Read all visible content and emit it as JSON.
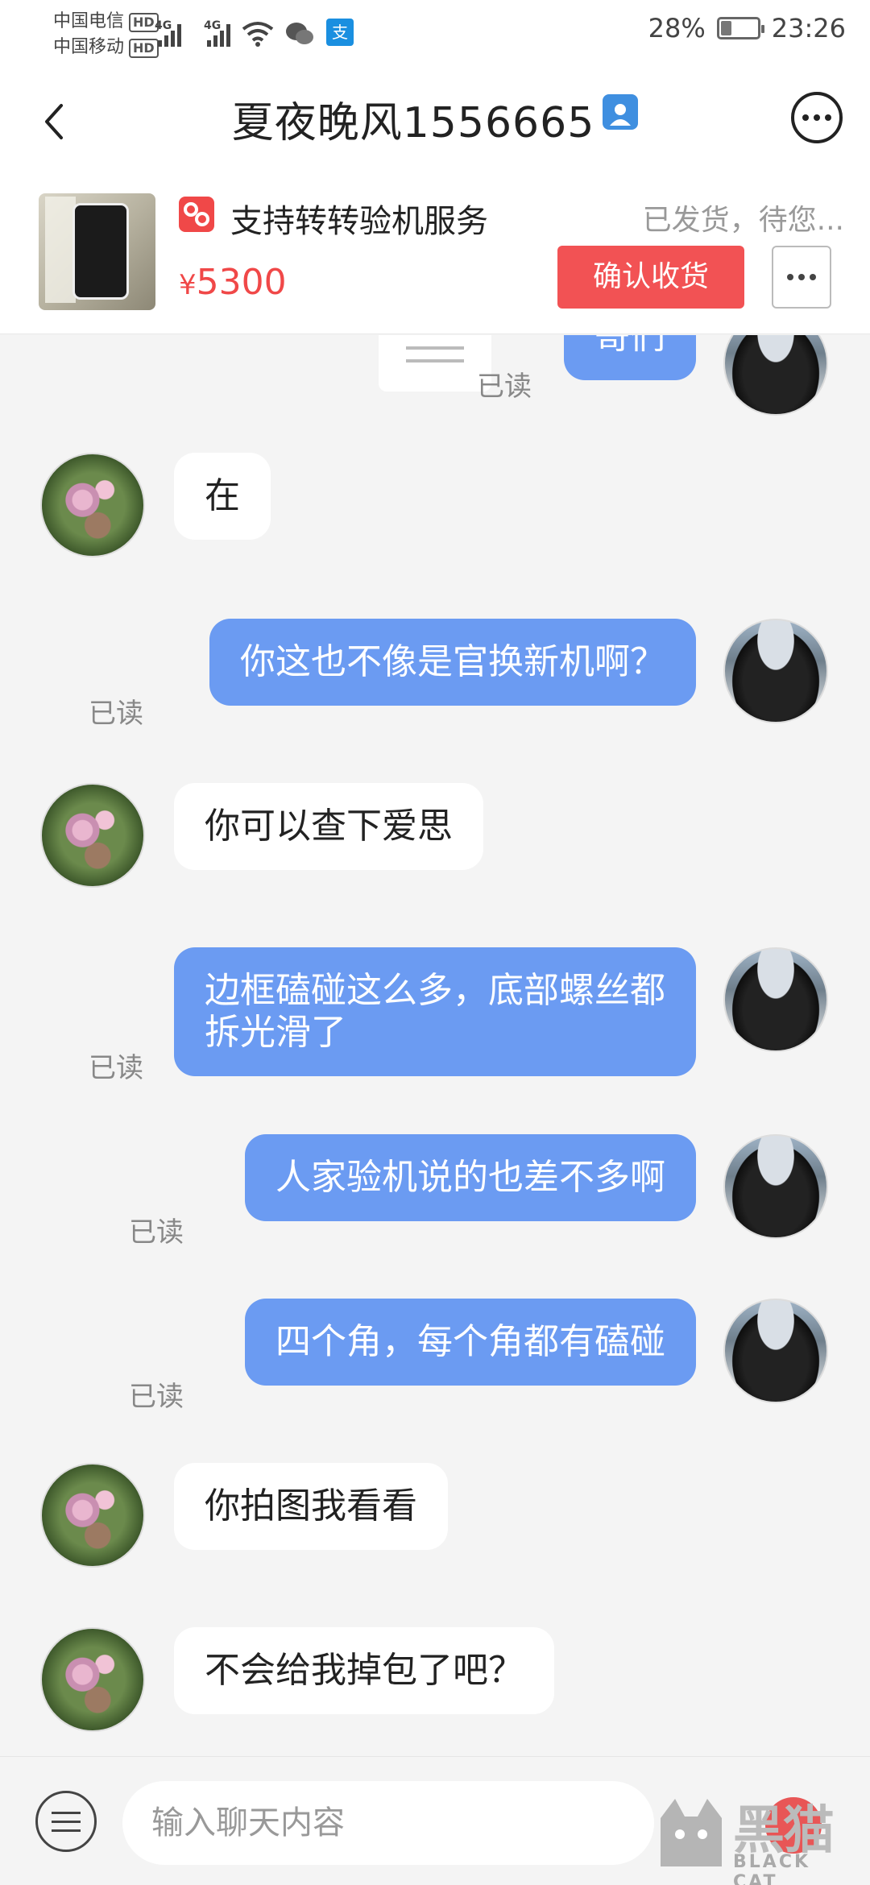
{
  "status_bar": {
    "carrier1": "中国电信",
    "carrier2": "中国移动",
    "hd_label": "HD",
    "network_label": "4G",
    "battery": "28%",
    "battery_level": 0.28,
    "time": "23:26"
  },
  "header": {
    "title": "夏夜晚风1556665"
  },
  "product": {
    "service_text": "支持转转验机服务",
    "order_status": "已发货，待您...",
    "price_symbol": "¥",
    "price_value": "5300",
    "confirm_label": "确认收货"
  },
  "chat": {
    "messages": [
      {
        "side": "right",
        "text": "哥们",
        "read": "已读"
      },
      {
        "side": "left",
        "text": "在"
      },
      {
        "side": "right",
        "text": "你这也不像是官换新机啊？",
        "read": "已读"
      },
      {
        "side": "left",
        "text": "你可以查下爱思"
      },
      {
        "side": "right",
        "text": "边框磕碰这么多，底部螺丝都拆光滑了",
        "read": "已读"
      },
      {
        "side": "right",
        "text": "人家验机说的也差不多啊",
        "read": "已读"
      },
      {
        "side": "right",
        "text": "四个角，每个角都有磕碰",
        "read": "已读"
      },
      {
        "side": "left",
        "text": "你拍图我看看"
      },
      {
        "side": "left",
        "text": "不会给我掉包了吧？"
      }
    ]
  },
  "input_bar": {
    "placeholder": "输入聊天内容"
  },
  "watermark": {
    "text": "黑猫",
    "subtext": "BLACK CAT"
  }
}
